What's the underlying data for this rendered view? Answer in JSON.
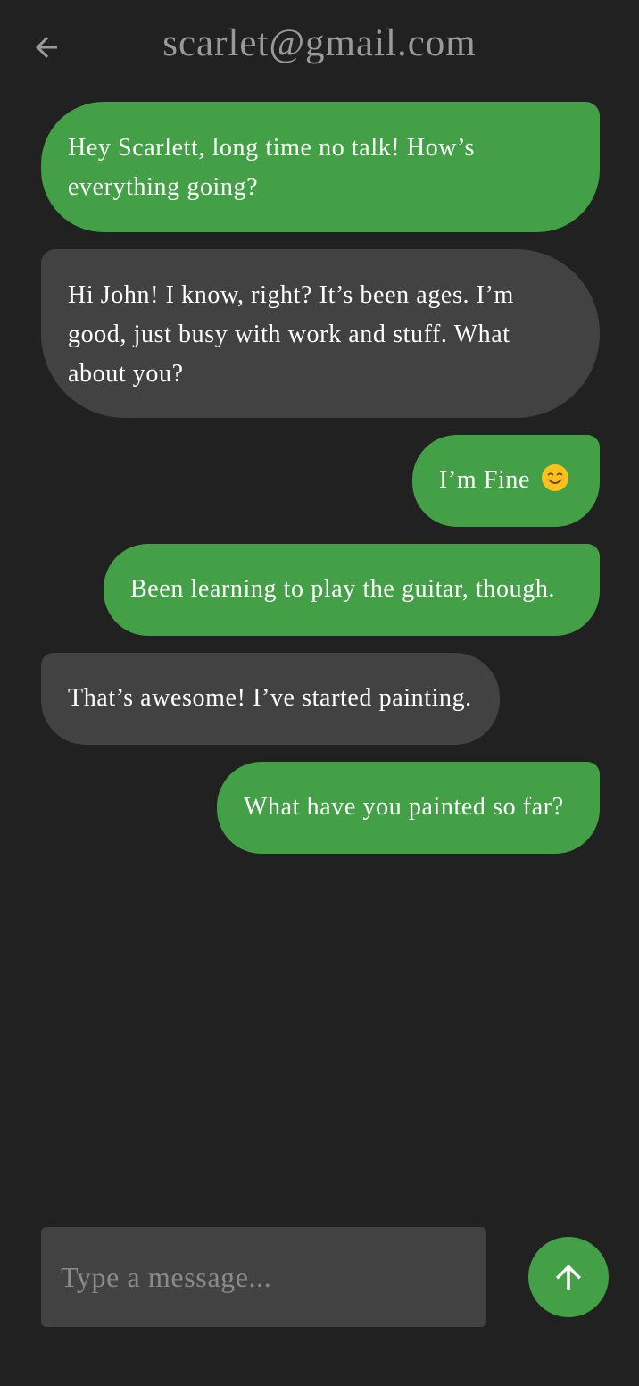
{
  "header": {
    "title": "scarlet@gmail.com",
    "back_icon": "arrow-left-icon"
  },
  "messages": [
    {
      "sender": "me",
      "text": "Hey Scarlett, long time no talk! How’s everything going?"
    },
    {
      "sender": "other",
      "text": "Hi John! I know, right? It’s been ages. I’m good, just busy with work and stuff. What about you?"
    },
    {
      "sender": "me",
      "text": "I’m Fine",
      "emoji": "smiling-face-icon"
    },
    {
      "sender": "me",
      "text": "Been learning to play the guitar, though."
    },
    {
      "sender": "other",
      "text": "That’s awesome! I’ve started painting."
    },
    {
      "sender": "me",
      "text": "What have you painted so far?"
    }
  ],
  "composer": {
    "placeholder": "Type a message...",
    "value": "",
    "send_icon": "arrow-up-icon"
  },
  "colors": {
    "background": "#212121",
    "sent_bubble": "#43a047",
    "received_bubble": "#424242",
    "title_text": "#9a9a9a"
  }
}
